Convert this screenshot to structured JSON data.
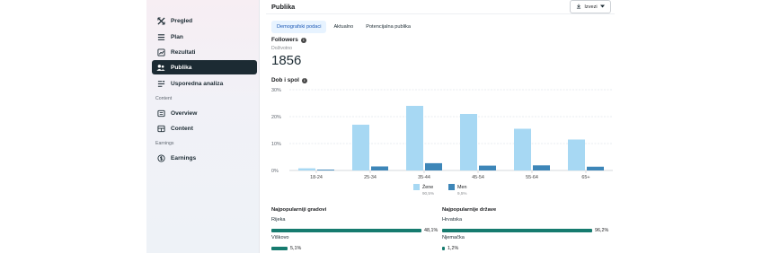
{
  "sidebar": {
    "items": [
      {
        "label": "Pregled",
        "icon": "cross-arrows-icon"
      },
      {
        "label": "Plan",
        "icon": "list-icon"
      },
      {
        "label": "Rezultati",
        "icon": "chart-box-icon"
      },
      {
        "label": "Publika",
        "icon": "people-icon"
      },
      {
        "label": "Usporedna analiza",
        "icon": "compare-icon"
      }
    ],
    "section_content": "Content",
    "content_items": [
      {
        "label": "Overview",
        "icon": "overview-icon"
      },
      {
        "label": "Content",
        "icon": "content-grid-icon"
      }
    ],
    "section_earnings": "Earnings",
    "earnings_items": [
      {
        "label": "Earnings",
        "icon": "dollar-circle-icon"
      }
    ]
  },
  "main": {
    "title": "Publika",
    "export_label": "Izvezi",
    "tabs": [
      "Demografski podaci",
      "Aktualno",
      "Potencijalna publika"
    ],
    "followers_label": "Followers",
    "followers_sub": "Doživotno",
    "followers_value": "1856",
    "age_gender_label": "Dob i spol"
  },
  "chart_data": {
    "type": "bar",
    "categories": [
      "18-24",
      "25-34",
      "35-44",
      "45-54",
      "55-64",
      "65+"
    ],
    "ytick_labels": [
      "0%",
      "10%",
      "20%",
      "30%"
    ],
    "ylim": [
      0,
      30
    ],
    "series": [
      {
        "name": "Žene",
        "color": "#a7d8f3",
        "values": [
          0.8,
          17,
          24,
          21,
          15.5,
          11.5
        ],
        "share": "90,5%"
      },
      {
        "name": "Men",
        "color": "#3d86b8",
        "values": [
          0.3,
          1.5,
          2.7,
          1.8,
          1.9,
          1.4
        ],
        "share": "9,5%"
      }
    ]
  },
  "cities": {
    "title": "Najpopularniji gradovi",
    "items": [
      {
        "name": "Rijeka",
        "value": "48,1%",
        "fraction": 0.481
      },
      {
        "name": "Viškovo",
        "value": "5,1%",
        "fraction": 0.051
      }
    ]
  },
  "countries": {
    "title": "Najpopularnije države",
    "items": [
      {
        "name": "Hrvatska",
        "value": "96,2%",
        "fraction": 0.962
      },
      {
        "name": "Njemačka",
        "value": "1,2%",
        "fraction": 0.012
      }
    ]
  }
}
